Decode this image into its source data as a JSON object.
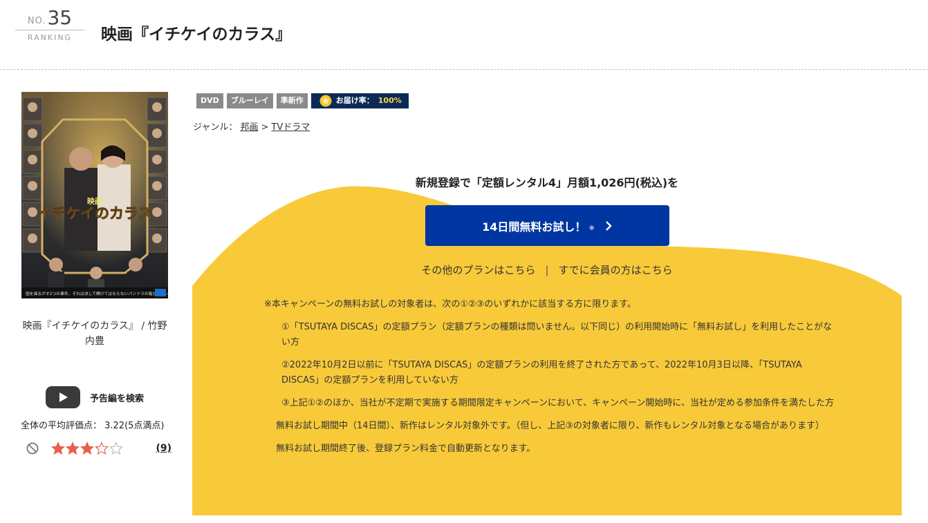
{
  "ranking": {
    "no_label": "NO.",
    "number": "35",
    "label": "RANKING"
  },
  "title": "映画『イチケイのカラス』",
  "cover": {
    "small_title": "映画",
    "main_title": "イチケイのカラス",
    "bottom_text": "国を揺るがす2つの事件、それは決して開けてはならないパンドラの箱だった——！？"
  },
  "cover_caption": "映画『イチケイのカラス』 / 竹野内豊",
  "trailer_label": "予告編を検索",
  "average_rating": "全体の平均評価点： 3.22(5点満点)",
  "rating": {
    "stars": 3.22,
    "max": 5,
    "count": "(9)"
  },
  "badges": {
    "dvd": "DVD",
    "bluray": "ブルーレイ",
    "semi_new": "準新作",
    "delivery_label": "お届け率：",
    "delivery_value": "100%"
  },
  "genre": {
    "label": "ジャンル：",
    "cat1": "邦画",
    "sep": ">",
    "cat2": "TVドラマ"
  },
  "promo": {
    "headline": "新規登録で「定額レンタル4」月額1,026円(税込)を",
    "button_label": "14日間無料お試し！",
    "button_mark": "※",
    "other_plans": "その他のプランはこちら",
    "divider": "|",
    "member_link": "すでに会員の方はこちら"
  },
  "notes": {
    "intro": "※本キャンペーンの無料お試しの対象者は、次の①②③のいずれかに該当する方に限ります。",
    "item1": "①「TSUTAYA DISCAS」の定額プラン（定額プランの種類は問いません。以下同じ）の利用開始時に「無料お試し」を利用したことがない方",
    "item2": "②2022年10月2日以前に「TSUTAYA DISCAS」の定額プランの利用を終了された方であって、2022年10月3日以降、「TSUTAYA DISCAS」の定額プランを利用していない方",
    "item3": "③上記①②のほか、当社が不定期で実施する期間限定キャンペーンにおいて、キャンペーン開始時に、当社が定める参加条件を満たした方",
    "note4": "無料お試し期間中（14日間）、新作はレンタル対象外です。（但し、上記③の対象者に限り、新作もレンタル対象となる場合があります）",
    "note5": "無料お試し期間終了後、登録プラン料金で自動更新となります。"
  },
  "colors": {
    "promo_yellow": "#f8ca3a",
    "button_blue": "#0036a1",
    "badge_gray": "#8a8a8a",
    "badge_navy": "#0c2a57",
    "star_red": "#e8604c"
  }
}
